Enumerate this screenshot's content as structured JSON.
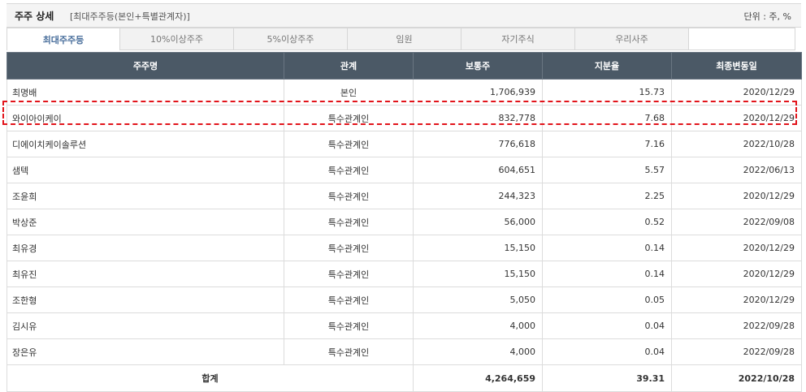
{
  "header": {
    "title": "주주 상세",
    "subtitle": "[최대주주등(본인+특별관계자)]",
    "unit": "단위 : 주, %"
  },
  "tabs": [
    {
      "label": "최대주주등"
    },
    {
      "label": "10%이상주주"
    },
    {
      "label": "5%이상주주"
    },
    {
      "label": "임원"
    },
    {
      "label": "자기주식"
    },
    {
      "label": "우리사주"
    },
    {
      "label": ""
    }
  ],
  "table": {
    "columns": [
      "주주명",
      "관계",
      "보통주",
      "지분율",
      "최종변동일"
    ],
    "rows": [
      {
        "name": "최명배",
        "relation": "본인",
        "shares": "1,706,939",
        "ratio": "15.73",
        "date": "2020/12/29"
      },
      {
        "name": "와이아이케이",
        "relation": "특수관계인",
        "shares": "832,778",
        "ratio": "7.68",
        "date": "2020/12/29"
      },
      {
        "name": "디에이치케이솔루션",
        "relation": "특수관계인",
        "shares": "776,618",
        "ratio": "7.16",
        "date": "2022/10/28"
      },
      {
        "name": "샘텍",
        "relation": "특수관계인",
        "shares": "604,651",
        "ratio": "5.57",
        "date": "2022/06/13"
      },
      {
        "name": "조윤희",
        "relation": "특수관계인",
        "shares": "244,323",
        "ratio": "2.25",
        "date": "2020/12/29"
      },
      {
        "name": "박상준",
        "relation": "특수관계인",
        "shares": "56,000",
        "ratio": "0.52",
        "date": "2022/09/08"
      },
      {
        "name": "최유경",
        "relation": "특수관계인",
        "shares": "15,150",
        "ratio": "0.14",
        "date": "2020/12/29"
      },
      {
        "name": "최유진",
        "relation": "특수관계인",
        "shares": "15,150",
        "ratio": "0.14",
        "date": "2020/12/29"
      },
      {
        "name": "조한형",
        "relation": "특수관계인",
        "shares": "5,050",
        "ratio": "0.05",
        "date": "2020/12/29"
      },
      {
        "name": "김시유",
        "relation": "특수관계인",
        "shares": "4,000",
        "ratio": "0.04",
        "date": "2022/09/28"
      },
      {
        "name": "장은유",
        "relation": "특수관계인",
        "shares": "4,000",
        "ratio": "0.04",
        "date": "2022/09/28"
      }
    ],
    "total": {
      "label": "합계",
      "shares": "4,264,659",
      "ratio": "39.31",
      "date": "2022/10/28"
    }
  },
  "colors": {
    "header_bg": "#4b5966",
    "highlight": "#e2141b",
    "active_tab": "#4a6f9c"
  }
}
